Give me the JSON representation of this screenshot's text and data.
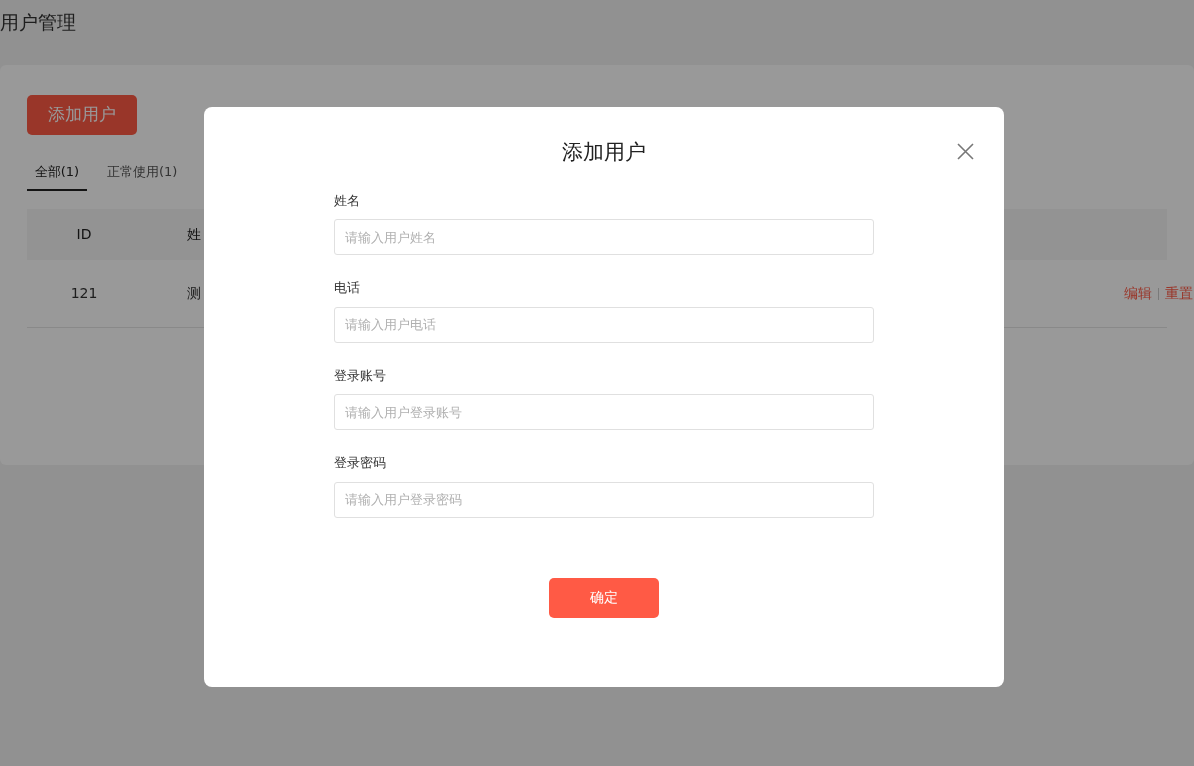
{
  "page_title": "用户管理",
  "add_button": "添加用户",
  "tabs": [
    {
      "label": "全部(1)",
      "selected": true
    },
    {
      "label": "正常使用(1)",
      "selected": false
    }
  ],
  "table": {
    "columns": [
      "ID",
      "姓"
    ],
    "rows": [
      {
        "cells": [
          "121",
          "测"
        ],
        "actions": [
          "编辑",
          "重置"
        ]
      }
    ]
  },
  "dialog": {
    "title": "添加用户",
    "fields": [
      {
        "label": "姓名",
        "placeholder": "请输入用户姓名"
      },
      {
        "label": "电话",
        "placeholder": "请输入用户电话"
      },
      {
        "label": "登录账号",
        "placeholder": "请输入用户登录账号"
      },
      {
        "label": "登录密码",
        "placeholder": "请输入用户登录密码"
      }
    ],
    "submit": "确定"
  }
}
